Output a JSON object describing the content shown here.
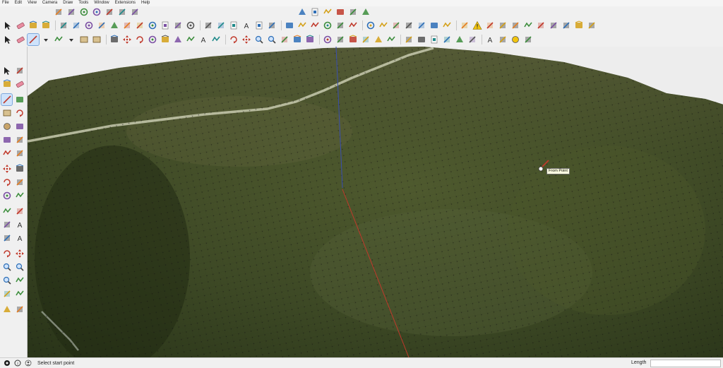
{
  "menubar": {
    "items": [
      "File",
      "Edit",
      "View",
      "Camera",
      "Draw",
      "Tools",
      "Window",
      "Extensions",
      "Help"
    ]
  },
  "icons": {
    "row0_left": [
      "section-plane-icon",
      "section-display-icon",
      "section-fill-icon",
      "section-cut-icon",
      "section-faces-icon",
      "section-lines-icon",
      "section-edit-icon"
    ],
    "row0_right": [
      "iso-view-icon",
      "top-view-icon",
      "front-view-icon",
      "right-view-icon",
      "back-view-icon",
      "left-view-icon"
    ],
    "row1": [
      "select-icon",
      "eraser-icon",
      "paint-bucket-icon",
      "new-file-icon",
      "open-file-icon",
      "save-icon",
      "cut-icon",
      "copy-icon",
      "paste-icon",
      "undo-icon",
      "redo-icon",
      "print-icon",
      "model-info-icon",
      "xray-icon",
      "back-edges-icon",
      "wireframe-icon",
      "hidden-line-icon",
      "shaded-icon",
      "shaded-texture-icon",
      "monochrome-icon",
      "iso-camera-icon",
      "top-camera-icon",
      "front-camera-icon",
      "right-camera-icon",
      "back-camera-icon",
      "left-camera-icon",
      "sandbox-from-contours-icon",
      "sandbox-from-scratch-icon",
      "smoove-icon",
      "stamp-icon",
      "drape-icon",
      "add-detail-icon",
      "flip-edge-icon",
      "add-location-icon",
      "toggle-terrain-icon",
      "warning-icon",
      "components-icon",
      "geo-location-icon",
      "follow-me-icon",
      "offset-icon",
      "dimension-icon",
      "protractor-icon",
      "axes-icon",
      "pen-icon",
      "arrow-icon"
    ],
    "row2": [
      "select-tool-icon",
      "eraser-tool-icon",
      "line-tool-icon",
      "line-dropdown-icon",
      "arc-tool-icon",
      "arc-dropdown-icon",
      "shape-tool-icon",
      "shape-dropdown-icon",
      "push-pull-icon",
      "move-icon",
      "rotate-icon",
      "scale-icon",
      "follow-me-tool-icon",
      "offset-tool-icon",
      "tape-measure-icon",
      "text-tool-icon",
      "paint-tool-icon",
      "orbit-icon",
      "pan-icon",
      "zoom-icon",
      "zoom-extents-icon",
      "warehouse-icon",
      "extension-warehouse-icon",
      "layout-icon",
      "styles-icon",
      "shadows-icon",
      "fog-icon",
      "position-camera-icon",
      "walk-icon",
      "look-around-icon",
      "section-plane-tool-icon",
      "outliner-icon",
      "scenes-icon",
      "dimensions-icon",
      "protractor-tool-icon",
      "axes-tool-icon",
      "3d-text-icon",
      "solid-tools-icon",
      "sun-icon",
      "soften-icon"
    ],
    "left_palette": [
      [
        "select-tool-icon",
        "make-component-icon"
      ],
      [
        "paint-bucket-icon",
        "eraser-icon"
      ],
      [
        "line-tool-icon",
        "freehand-icon"
      ],
      [
        "rectangle-icon",
        "rotated-rectangle-icon"
      ],
      [
        "circle-icon",
        "polygon-icon"
      ],
      [
        "arc-icon",
        "two-point-arc-icon"
      ],
      [
        "three-point-arc-icon",
        "pie-icon"
      ],
      [
        "move-icon",
        "push-pull-icon"
      ],
      [
        "rotate-icon",
        "follow-me-icon"
      ],
      [
        "scale-icon",
        "offset-icon"
      ],
      [
        "tape-measure-icon",
        "dimension-icon"
      ],
      [
        "protractor-icon",
        "text-icon"
      ],
      [
        "axes-icon",
        "3d-text-icon"
      ],
      [
        "orbit-icon",
        "pan-icon"
      ],
      [
        "zoom-icon",
        "zoom-window-icon"
      ],
      [
        "zoom-extents-icon",
        "previous-view-icon"
      ],
      [
        "position-camera-icon",
        "look-around-icon"
      ],
      [
        "walk-icon",
        "section-plane-icon"
      ]
    ]
  },
  "viewport": {
    "tooltip": "From Point",
    "axis_colors": {
      "blue": "#3a4fb0",
      "red": "#c0392b"
    },
    "terrain_color": "#3d4a25",
    "sky_color": "#ededed"
  },
  "statusbar": {
    "status_text": "Select start point",
    "measurement_label": "Length",
    "measurement_value": ""
  }
}
